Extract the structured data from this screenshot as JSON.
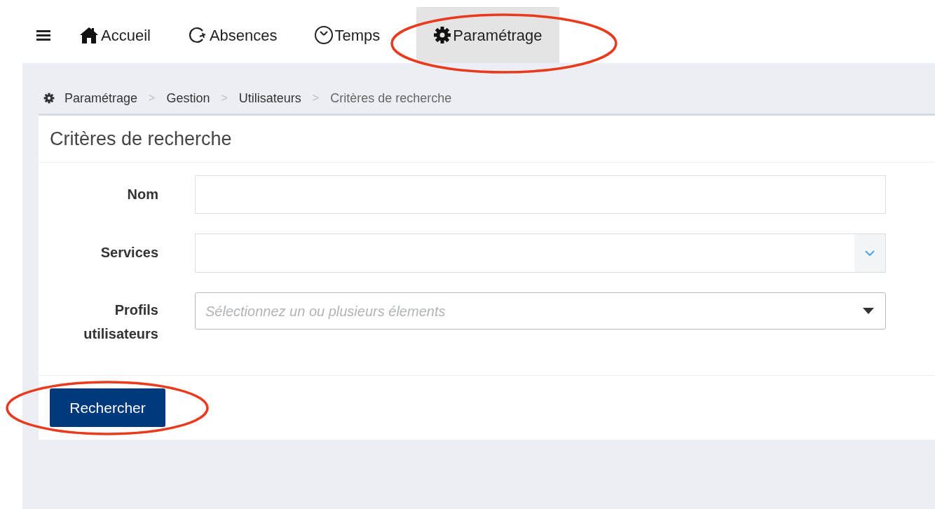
{
  "nav": {
    "tabs": [
      {
        "label": "Accueil",
        "kind": "home",
        "selected": false,
        "highlighted": false
      },
      {
        "label": "Absences",
        "kind": "refresh",
        "selected": false,
        "highlighted": false
      },
      {
        "label": "Temps",
        "kind": "clock",
        "selected": false,
        "highlighted": false
      },
      {
        "label": "Paramétrage",
        "kind": "gear",
        "selected": true,
        "highlighted": true
      }
    ]
  },
  "breadcrumb": [
    {
      "label": "Paramétrage",
      "current": false
    },
    {
      "label": "Gestion",
      "current": false
    },
    {
      "label": "Utilisateurs",
      "current": false
    },
    {
      "label": "Critères de recherche",
      "current": true
    }
  ],
  "breadcrumb_separator": ">",
  "panel": {
    "title": "Critères de recherche",
    "fields": [
      {
        "kind": "text",
        "label": "Nom"
      },
      {
        "kind": "select",
        "label": "Services"
      },
      {
        "kind": "multiselect",
        "label": "Profils utilisateurs",
        "placeholder": "Sélectionnez un ou plusieurs élements"
      }
    ],
    "button": {
      "label": "Rechercher",
      "highlighted": true
    }
  }
}
